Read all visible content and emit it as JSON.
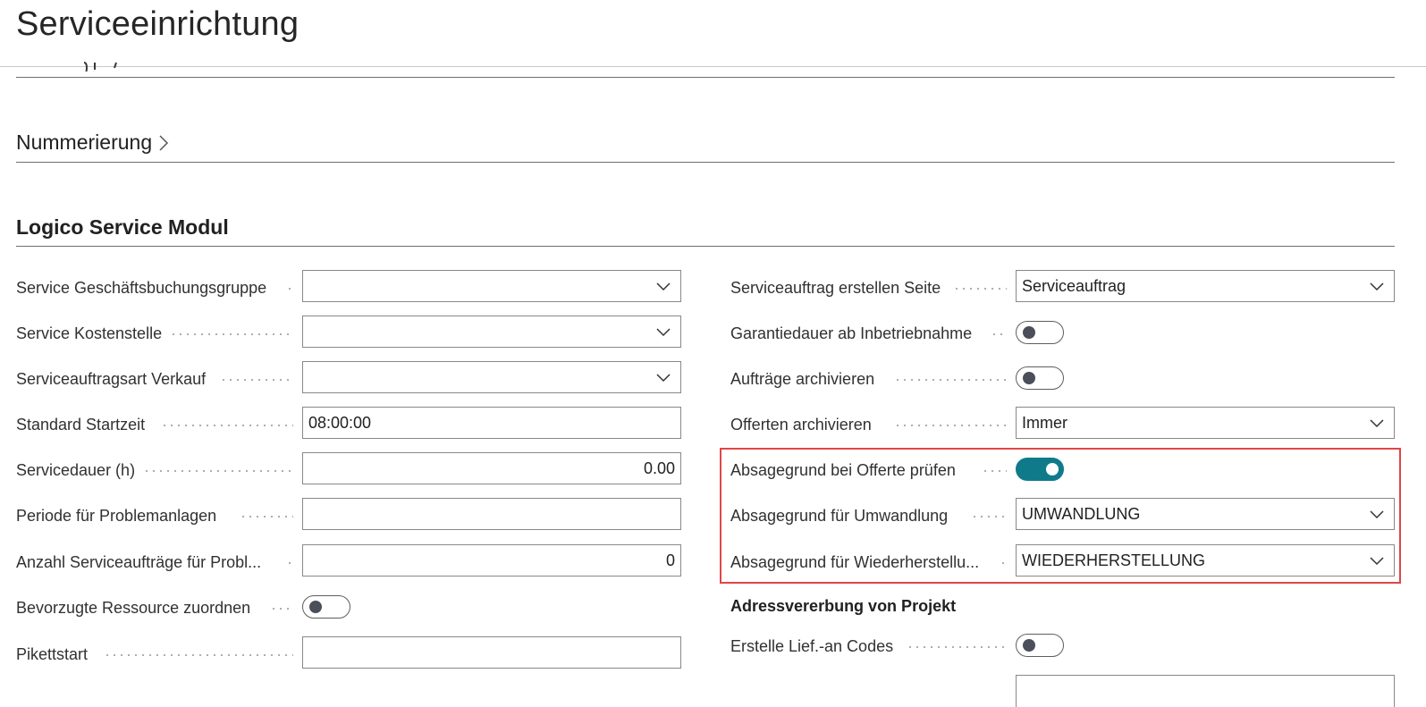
{
  "page": {
    "title": "Serviceeinrichtung"
  },
  "sections": {
    "numbering": {
      "title": "Nummerierung"
    },
    "logico": {
      "title": "Logico Service Modul"
    }
  },
  "left_fields": [
    {
      "label": "Service Geschäftsbuchungsgruppe",
      "type": "select",
      "value": ""
    },
    {
      "label": "Service Kostenstelle",
      "type": "select",
      "value": ""
    },
    {
      "label": "Serviceauftragsart Verkauf",
      "type": "select",
      "value": ""
    },
    {
      "label": "Standard Startzeit",
      "type": "text",
      "value": "08:00:00"
    },
    {
      "label": "Servicedauer (h)",
      "type": "number",
      "value": "0.00"
    },
    {
      "label": "Periode für Problemanlagen",
      "type": "text",
      "value": ""
    },
    {
      "label": "Anzahl Serviceaufträge für Probl...",
      "type": "number",
      "value": "0"
    },
    {
      "label": "Bevorzugte Ressource zuordnen",
      "type": "toggle",
      "on": false
    },
    {
      "label": "Pikettstart",
      "type": "text",
      "value": ""
    }
  ],
  "right_fields": [
    {
      "label": "Serviceauftrag erstellen Seite",
      "type": "select",
      "value": "Serviceauftrag"
    },
    {
      "label": "Garantiedauer ab Inbetriebnahme",
      "type": "toggle",
      "on": false
    },
    {
      "label": "Aufträge archivieren",
      "type": "toggle",
      "on": false
    },
    {
      "label": "Offerten archivieren",
      "type": "select",
      "value": "Immer"
    },
    {
      "label": "Absagegrund bei Offerte prüfen",
      "type": "toggle",
      "on": true
    },
    {
      "label": "Absagegrund für Umwandlung",
      "type": "select",
      "value": "UMWANDLUNG"
    },
    {
      "label": "Absagegrund für Wiederherstellu...",
      "type": "select",
      "value": "WIEDERHERSTELLUNG"
    }
  ],
  "address_group": {
    "title": "Adressvererbung von Projekt",
    "fields": [
      {
        "label": "Erstelle Lief.-an Codes",
        "type": "toggle",
        "on": false
      }
    ]
  },
  "colors": {
    "toggle_on": "#0f7b8a",
    "highlight_border": "#e04646",
    "input_border": "#8a8886"
  },
  "icons": {
    "dropdown": "chevron-down-icon",
    "section_expand": "chevron-right-icon"
  }
}
